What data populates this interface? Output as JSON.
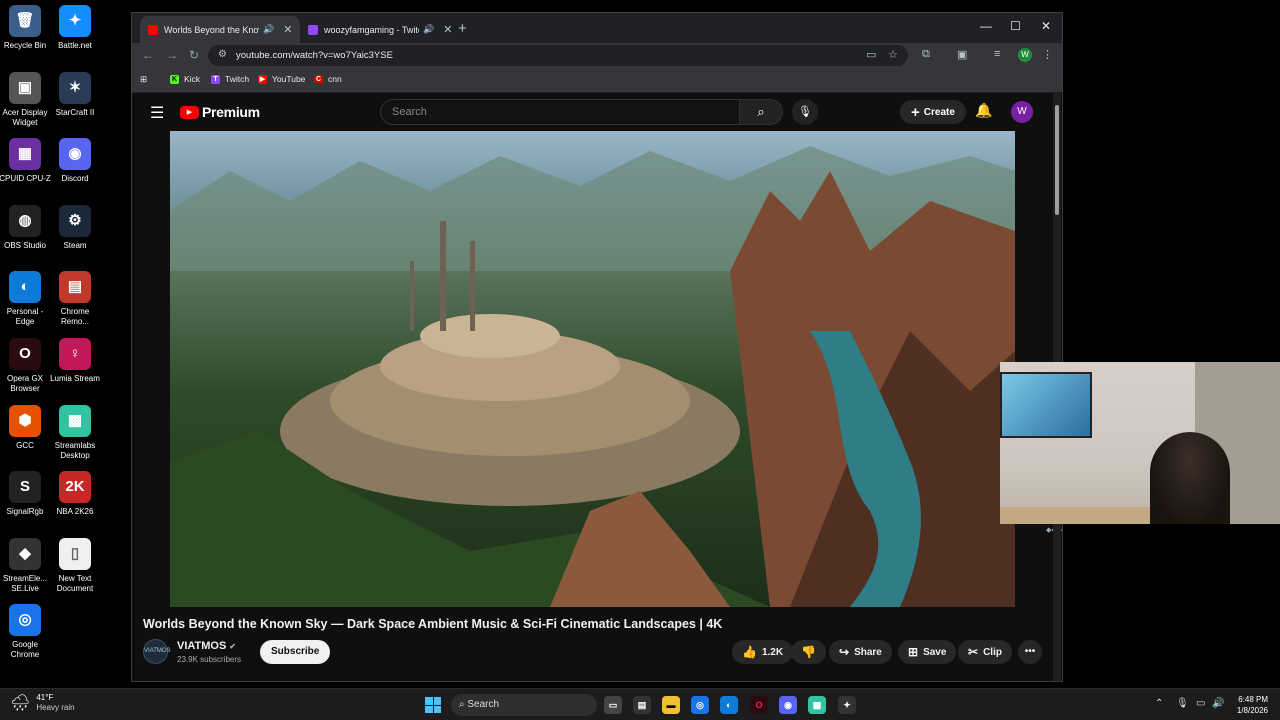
{
  "desktop": {
    "icons": [
      {
        "label": "Recycle Bin",
        "glyph": "🗑",
        "color": "#3a5f8a"
      },
      {
        "label": "Battle.net",
        "glyph": "✦",
        "color": "#148eff"
      },
      {
        "label": "Acer Display Widget",
        "glyph": "▣",
        "color": "#555"
      },
      {
        "label": "StarCraft II",
        "glyph": "✶",
        "color": "#2b3a55"
      },
      {
        "label": "CPUID CPU-Z",
        "glyph": "▦",
        "color": "#6a2fa0"
      },
      {
        "label": "Discord",
        "glyph": "◉",
        "color": "#5865f2"
      },
      {
        "label": "OBS Studio",
        "glyph": "◍",
        "color": "#222"
      },
      {
        "label": "Steam",
        "glyph": "⚙",
        "color": "#1b2838"
      },
      {
        "label": "Personal - Edge",
        "glyph": "◐",
        "color": "#0f7bd8"
      },
      {
        "label": "Chrome Remo...",
        "glyph": "▤",
        "color": "#c0392b"
      },
      {
        "label": "Opera GX Browser",
        "glyph": "O",
        "color": "#2a0b0f"
      },
      {
        "label": "Lumia Stream",
        "glyph": "♀",
        "color": "#c2185b"
      },
      {
        "label": "GCC",
        "glyph": "⬢",
        "color": "#e65100"
      },
      {
        "label": "Streamlabs Desktop",
        "glyph": "▩",
        "color": "#31c3a2"
      },
      {
        "label": "SignalRgb",
        "glyph": "S",
        "color": "#222"
      },
      {
        "label": "NBA 2K26",
        "glyph": "2K",
        "color": "#c62828"
      },
      {
        "label": "StreamEle... SE.Live",
        "glyph": "◆",
        "color": "#333"
      },
      {
        "label": "New Text Document",
        "glyph": "▯",
        "color": "#f0f0f0"
      },
      {
        "label": "Google Chrome",
        "glyph": "◎",
        "color": "#1a73e8"
      }
    ]
  },
  "browser": {
    "tabs": [
      {
        "title": "Worlds Beyond the Known",
        "favicon_color": "#ff0000",
        "active": true
      },
      {
        "title": "woozyfamgaming - Twitch",
        "favicon_color": "#9146ff",
        "active": false
      }
    ],
    "new_tab": "+",
    "window_controls": {
      "minimize": "—",
      "maximize": "☐",
      "close": "✕"
    },
    "url": "youtube.com/watch?v=wo7Yaic3YSE",
    "profile_initial": "W",
    "bookmarks": [
      {
        "label": "Kick",
        "glyph": "K",
        "color": "#53fc18"
      },
      {
        "label": "Twitch",
        "glyph": "T",
        "color": "#9146ff"
      },
      {
        "label": "YouTube",
        "glyph": "▶",
        "color": "#ff0000"
      },
      {
        "label": "cnn",
        "glyph": "C",
        "color": "#cc0000"
      }
    ]
  },
  "youtube": {
    "logo_text": "Premium",
    "search_placeholder": "Search",
    "create_label": "Create",
    "avatar_initial": "W",
    "video_title": "Worlds Beyond the Known Sky — Dark Space Ambient Music & Sci-Fi Cinematic Landscapes | 4K",
    "channel_name": "VIATMOS",
    "channel_avatar_text": "VIATMOS",
    "subscribers": "23.9K subscribers",
    "subscribe_label": "Subscribe",
    "likes": "1.2K",
    "share_label": "Share",
    "save_label": "Save",
    "clip_label": "Clip"
  },
  "taskbar": {
    "temperature": "41°F",
    "weather": "Heavy rain",
    "search_label": "Search",
    "time": "6:48 PM",
    "date": "1/8/2026"
  }
}
